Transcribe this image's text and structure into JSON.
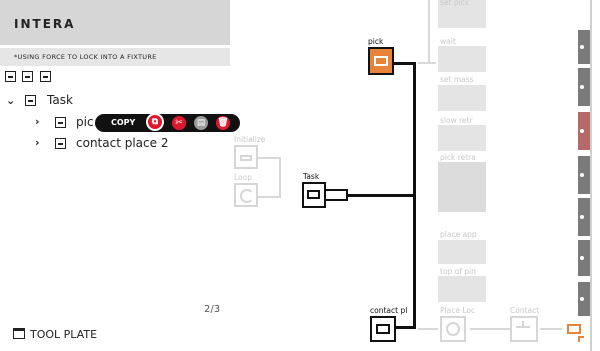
{
  "panel": {
    "title": "INTERA",
    "subtitle": "*USING FORCE TO LOCK INTO A FIXTURE",
    "tree": {
      "root_label": "Task",
      "item1_label": "pic",
      "item2_label": "contact place 2"
    },
    "context_menu": {
      "copy_label": "COPY"
    },
    "pager": "2/3",
    "tool_label": "TOOL PLATE"
  },
  "canvas": {
    "node_labels": {
      "pick": "pick",
      "task": "Task",
      "contact": "contact pl",
      "initialize": "Initialize",
      "loop": "Loop",
      "contact_small": "Contact"
    },
    "column_labels": [
      "set pick",
      "wait",
      "set mass",
      "slow retr",
      "pick retra",
      "place app",
      "top of pin",
      "Place Loc"
    ],
    "colors": {
      "pick_node": "#e8843a",
      "accent_red": "#e0182d",
      "side_red": "#b56a6a",
      "wire": "#111111"
    }
  }
}
